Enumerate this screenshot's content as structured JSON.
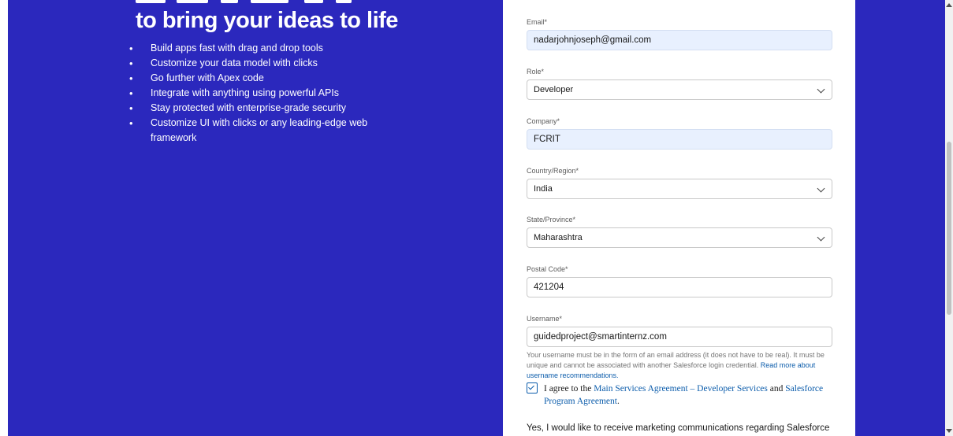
{
  "hero": {
    "headline": "to bring your ideas to life",
    "features": [
      "Build apps fast with drag and drop tools",
      "Customize your data model with clicks",
      "Go further with Apex code",
      "Integrate with anything using powerful APIs",
      "Stay protected with enterprise-grade security",
      "Customize UI with clicks or any leading-edge web framework"
    ]
  },
  "form": {
    "email": {
      "label": "Email*",
      "value": "nadarjohnjoseph@gmail.com"
    },
    "role": {
      "label": "Role*",
      "value": "Developer"
    },
    "company": {
      "label": "Company*",
      "value": "FCRIT"
    },
    "country": {
      "label": "Country/Region*",
      "value": "India"
    },
    "state": {
      "label": "State/Province*",
      "value": "Maharashtra"
    },
    "postal": {
      "label": "Postal Code*",
      "value": "421204"
    },
    "username": {
      "label": "Username*",
      "value": "guidedproject@smartinternz.com"
    },
    "username_help": "Your username must be in the form of an email address (it does not have to be real). It must be unique and cannot be associated with another Salesforce login credential.",
    "username_help_link": "Read more about username recommendations.",
    "agree": {
      "prefix": "I agree to the ",
      "link1": "Main Services Agreement – Developer Services",
      "middle": " and ",
      "link2": "Salesforce Program Agreement",
      "suffix": "."
    },
    "marketing": "Yes, I would like to receive marketing communications regarding Salesforce"
  },
  "colors": {
    "background": "#2b28bd",
    "link": "#0b5cab",
    "autofill": "#e8f0fe"
  }
}
